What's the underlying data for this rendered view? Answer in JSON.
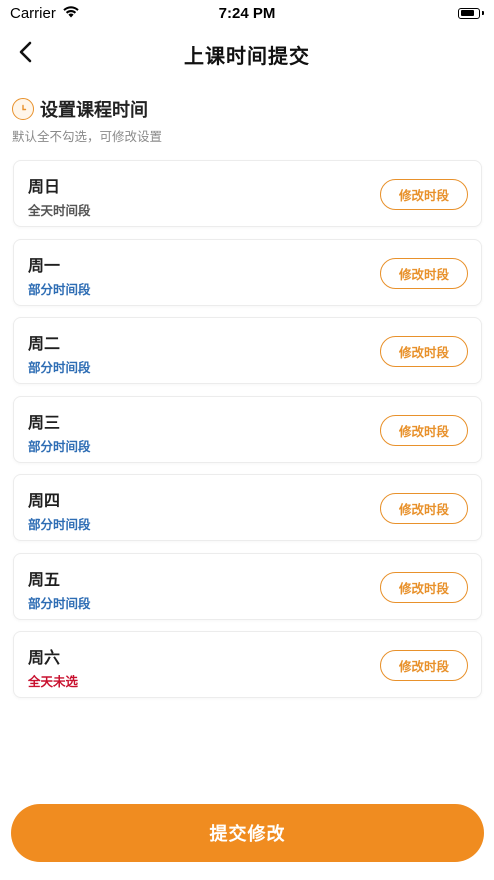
{
  "status_bar": {
    "carrier": "Carrier",
    "time": "7:24 PM",
    "icons": [
      "wifi-icon",
      "battery-icon"
    ]
  },
  "nav": {
    "title": "上课时间提交",
    "back_icon": "chevron-left-icon"
  },
  "section": {
    "icon": "clock-icon",
    "title": "设置课程时间",
    "hint": "默认全不勾选，可修改设置"
  },
  "colors": {
    "accent": "#E8912B",
    "submit_bg": "#F08C20",
    "status_all_day": "#555555",
    "status_partial": "#2E6DB4",
    "status_none": "#C8102E"
  },
  "days": [
    {
      "name": "周日",
      "status": "全天时间段",
      "status_type": "all_day",
      "button": "修改时段"
    },
    {
      "name": "周一",
      "status": "部分时间段",
      "status_type": "partial",
      "button": "修改时段"
    },
    {
      "name": "周二",
      "status": "部分时间段",
      "status_type": "partial",
      "button": "修改时段"
    },
    {
      "name": "周三",
      "status": "部分时间段",
      "status_type": "partial",
      "button": "修改时段"
    },
    {
      "name": "周四",
      "status": "部分时间段",
      "status_type": "partial",
      "button": "修改时段"
    },
    {
      "name": "周五",
      "status": "部分时间段",
      "status_type": "partial",
      "button": "修改时段"
    },
    {
      "name": "周六",
      "status": "全天未选",
      "status_type": "none",
      "button": "修改时段"
    }
  ],
  "submit": {
    "label": "提交修改"
  }
}
